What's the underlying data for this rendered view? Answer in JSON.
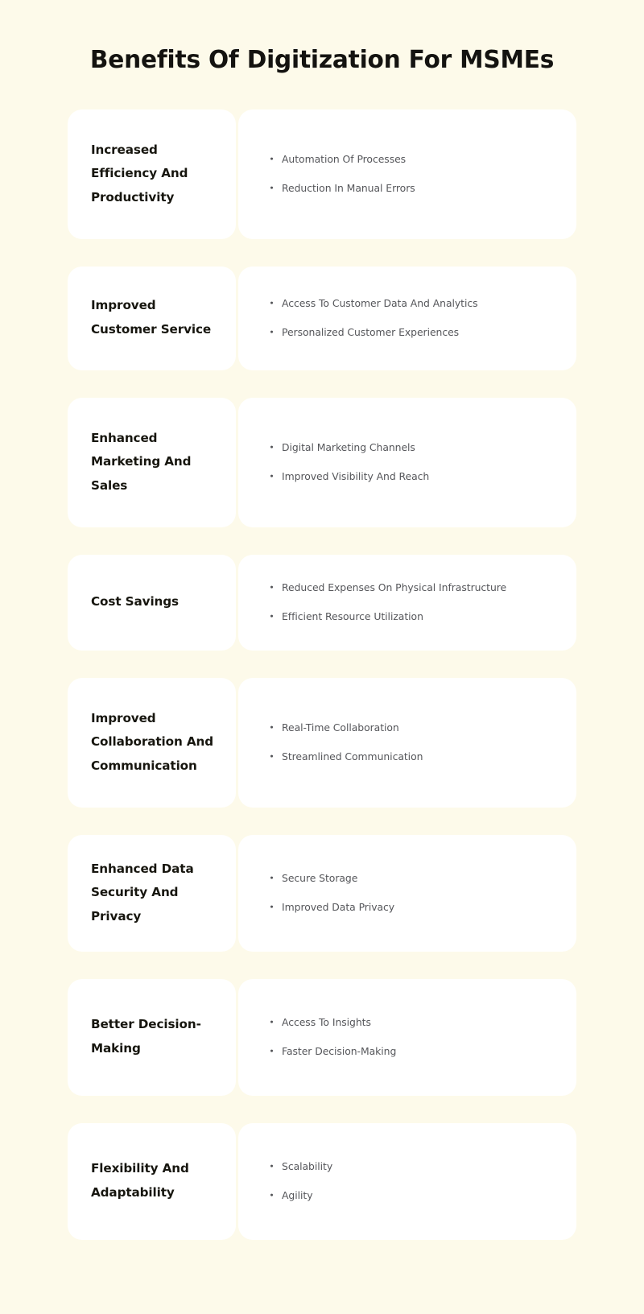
{
  "page": {
    "title": "Benefits Of Digitization For MSMEs",
    "background_color": "#fdfaea",
    "card_color": "#ffffff",
    "title_color": "#141310",
    "benefit_title_color": "#17160f",
    "point_text_color": "#55565a",
    "bullet_glyph": "·"
  },
  "benefits": [
    {
      "title": "Increased Efficiency And Productivity",
      "points": [
        "Automation Of Processes",
        "Reduction In Manual Errors"
      ]
    },
    {
      "title": "Improved Customer Service",
      "points": [
        "Access To Customer Data And Analytics",
        "Personalized Customer Experiences"
      ]
    },
    {
      "title": "Enhanced Marketing And Sales",
      "points": [
        "Digital Marketing Channels",
        "Improved Visibility And Reach"
      ]
    },
    {
      "title": "Cost Savings",
      "points": [
        "Reduced Expenses On Physical Infrastructure",
        "Efficient Resource Utilization"
      ]
    },
    {
      "title": "Improved Collaboration And Communication",
      "points": [
        "Real-Time Collaboration",
        "Streamlined Communication"
      ]
    },
    {
      "title": "Enhanced Data Security And Privacy",
      "points": [
        "Secure Storage",
        "Improved Data Privacy"
      ]
    },
    {
      "title": "Better Decision-Making",
      "points": [
        "Access To Insights",
        "Faster Decision-Making"
      ]
    },
    {
      "title": "Flexibility And Adaptability",
      "points": [
        "Scalability",
        "Agility"
      ]
    }
  ]
}
